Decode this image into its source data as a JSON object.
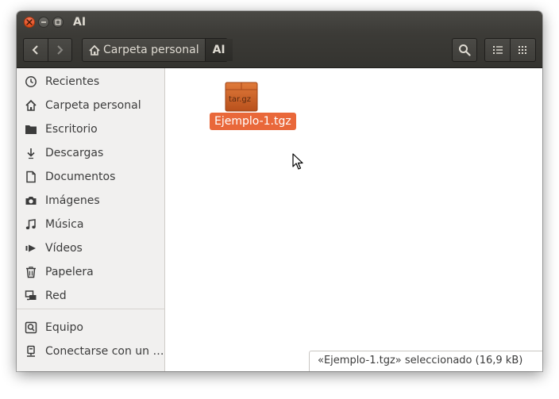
{
  "window": {
    "title": "AI"
  },
  "toolbar": {
    "back_icon": "chevron-left-icon",
    "forward_icon": "chevron-right-icon",
    "path": [
      {
        "label": "Carpeta personal",
        "icon": "home-icon"
      },
      {
        "label": "AI"
      }
    ],
    "search_icon": "search-icon",
    "list_view_icon": "list-view-icon",
    "grid_view_icon": "grid-view-icon"
  },
  "sidebar": {
    "items": [
      {
        "label": "Recientes",
        "icon": "clock-icon"
      },
      {
        "label": "Carpeta personal",
        "icon": "home-icon"
      },
      {
        "label": "Escritorio",
        "icon": "folder-icon"
      },
      {
        "label": "Descargas",
        "icon": "download-icon"
      },
      {
        "label": "Documentos",
        "icon": "document-icon"
      },
      {
        "label": "Imágenes",
        "icon": "camera-icon"
      },
      {
        "label": "Música",
        "icon": "music-icon"
      },
      {
        "label": "Vídeos",
        "icon": "video-icon"
      },
      {
        "label": "Papelera",
        "icon": "trash-icon"
      },
      {
        "label": "Red",
        "icon": "network-icon"
      }
    ],
    "devices": [
      {
        "label": "Equipo",
        "icon": "computer-icon"
      },
      {
        "label": "Conectarse con un …",
        "icon": "server-icon"
      }
    ]
  },
  "content": {
    "files": [
      {
        "name": "Ejemplo-1.tgz",
        "icon_text": "tar.gz",
        "selected": true
      }
    ]
  },
  "status": {
    "text": "«Ejemplo-1.tgz» seleccionado  (16,9 kB)"
  },
  "colors": {
    "accent": "#e9683a",
    "titlebar": "#3c3b37",
    "sidebar_bg": "#f1f0ef",
    "close_button": "#df4a16"
  }
}
